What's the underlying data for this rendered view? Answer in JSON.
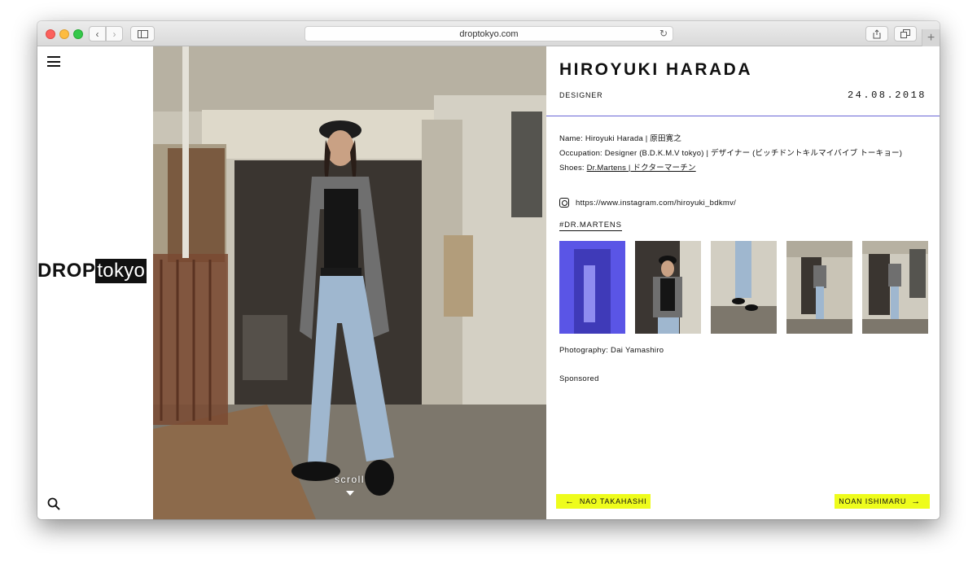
{
  "browser": {
    "url": "droptokyo.com",
    "back_glyph": "‹",
    "forward_glyph": "›",
    "reload_glyph": "↻",
    "new_tab_glyph": "+"
  },
  "logo": {
    "part1": "DROP",
    "part2": "tokyo"
  },
  "photo": {
    "scroll_label": "scroll",
    "colors": {
      "wall": "#c9c4b6",
      "floor": "#7d776c",
      "shadow": "#3a3530",
      "jeans": "#9fb7cf",
      "shirt": "#6f6f6f",
      "tank": "#151515",
      "hat": "#1d1d1d",
      "rust": "#7a4a32"
    }
  },
  "article": {
    "title": "HIROYUKI HARADA",
    "role": "DESIGNER",
    "date": "24.08.2018",
    "name_line": "Name: Hiroyuki Harada | 原田寛之",
    "occupation_line": "Occupation: Designer (B.D.K.M.V tokyo) | デザイナー (ビッチドントキルマイバイブ トーキョー)",
    "shoes_prefix": "Shoes: ",
    "shoes_link": "Dr.Martens | ドクターマーチン",
    "instagram_url": "https://www.instagram.com/hiroyuki_bdkmv/",
    "tag": "#DR.MARTENS",
    "photography": "Photography: Dai Yamashiro",
    "sponsored": "Sponsored",
    "prev_label": "NAO TAKAHASHI",
    "next_label": "NOAN ISHIMARU",
    "prev_arrow": "←",
    "next_arrow": "→"
  },
  "accent_colors": {
    "divider": "#6a66d6",
    "pager": "#eefc1c",
    "thumb_tint": "#5a55e6"
  }
}
